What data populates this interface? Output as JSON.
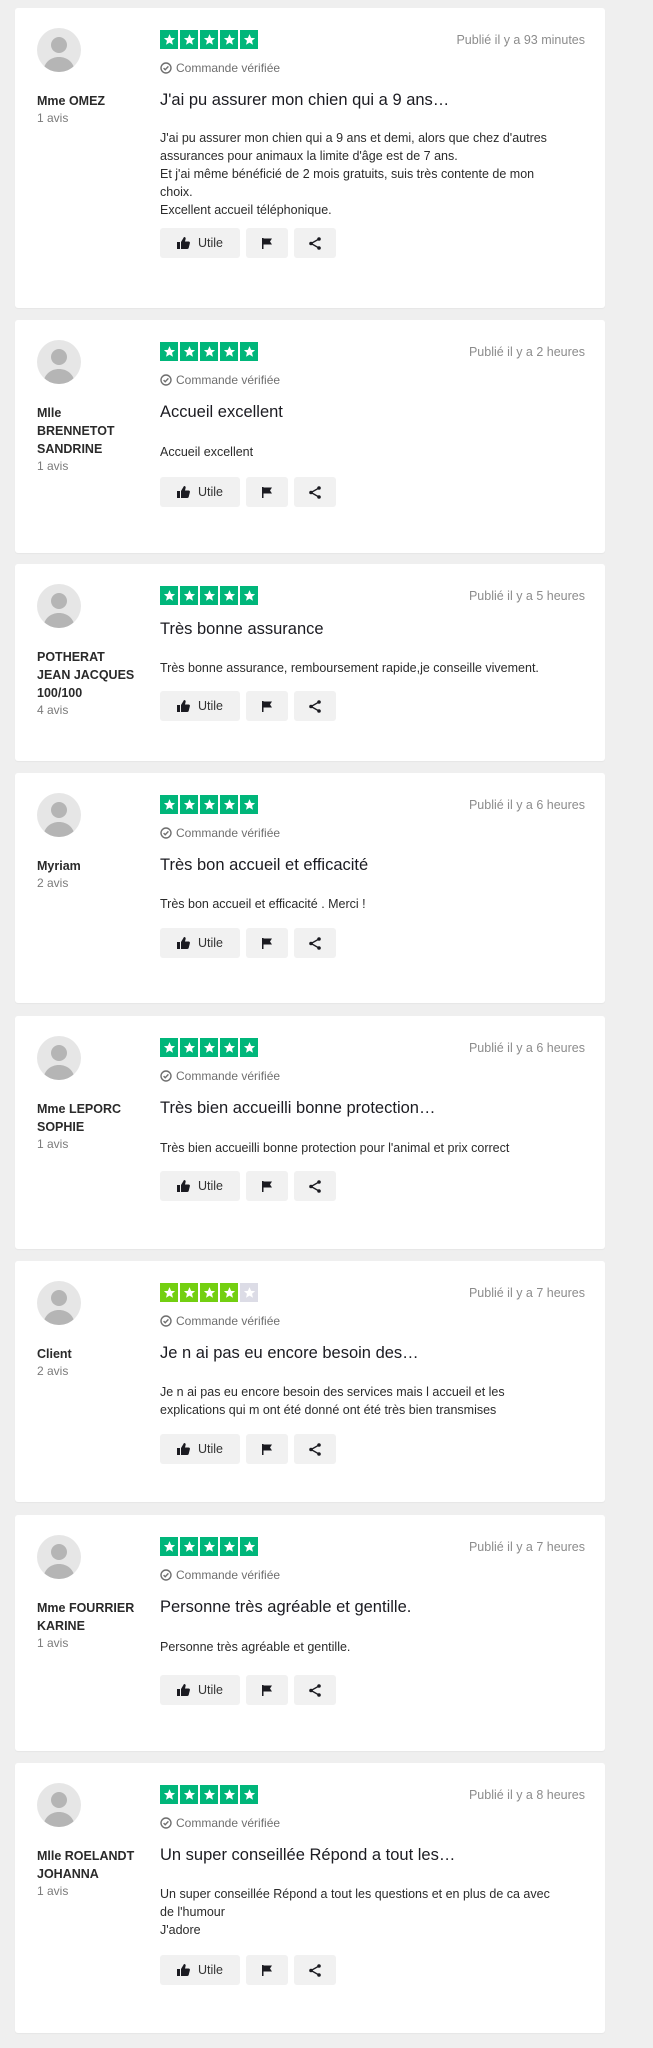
{
  "labels": {
    "verified": "Commande vérifiée",
    "useful": "Utile"
  },
  "colors": {
    "star_full": "#00b67a",
    "star_four": "#73cf11",
    "star_empty": "#dcdce6",
    "page_bg": "#efefef"
  },
  "icons": {
    "avatar": "avatar-icon",
    "verified": "check-circle-icon",
    "useful": "thumbs-up-icon",
    "flag": "flag-icon",
    "share": "share-icon"
  },
  "reviews": [
    {
      "author": "Mme OMEZ",
      "review_count": "1 avis",
      "rating": 5,
      "date": "Publié il y a 93 minutes",
      "verified": true,
      "title": "J'ai pu assurer mon chien qui a 9 ans…",
      "body": "J'ai pu assurer mon chien qui a 9 ans et demi, alors que chez d'autres\nassurances pour animaux la limite d'âge est de 7 ans.\nEt j'ai même bénéficié de 2 mois gratuits, suis très contente de mon\nchoix.\nExcellent accueil téléphonique."
    },
    {
      "author": "Mlle\nBRENNETOT\nSANDRINE",
      "review_count": "1 avis",
      "rating": 5,
      "date": "Publié il y a 2 heures",
      "verified": true,
      "title": "Accueil excellent",
      "body": "Accueil excellent"
    },
    {
      "author": "POTHERAT\nJEAN JACQUES\n100/100",
      "review_count": "4 avis",
      "rating": 5,
      "date": "Publié il y a 5 heures",
      "verified": false,
      "title": "Très bonne assurance",
      "body": "Très bonne assurance, remboursement rapide,je conseille vivement."
    },
    {
      "author": "Myriam",
      "review_count": "2 avis",
      "rating": 5,
      "date": "Publié il y a 6 heures",
      "verified": true,
      "title": "Très bon accueil et efficacité",
      "body": "Très bon accueil et efficacité . Merci !"
    },
    {
      "author": "Mme LEPORC\nSOPHIE",
      "review_count": "1 avis",
      "rating": 5,
      "date": "Publié il y a 6 heures",
      "verified": true,
      "title": "Très bien accueilli bonne protection…",
      "body": "Très bien accueilli bonne protection pour l'animal et prix correct"
    },
    {
      "author": "Client",
      "review_count": "2 avis",
      "rating": 4,
      "date": "Publié il y a 7 heures",
      "verified": true,
      "title": "Je n ai pas eu encore besoin des…",
      "body": "Je n ai pas eu encore besoin des services mais l accueil et les\nexplications qui m ont été donné ont été très bien transmises"
    },
    {
      "author": "Mme FOURRIER\nKARINE",
      "review_count": "1 avis",
      "rating": 5,
      "date": "Publié il y a 7 heures",
      "verified": true,
      "title": "Personne très agréable et gentille.",
      "body": "Personne très agréable et gentille."
    },
    {
      "author": "Mlle ROELANDT\nJOHANNA",
      "review_count": "1 avis",
      "rating": 5,
      "date": "Publié il y a 8 heures",
      "verified": true,
      "title": "Un super conseillée Répond a tout les…",
      "body": "Un super conseillée Répond a tout les questions et en plus de ca avec\nde l'humour\nJ'adore"
    }
  ]
}
